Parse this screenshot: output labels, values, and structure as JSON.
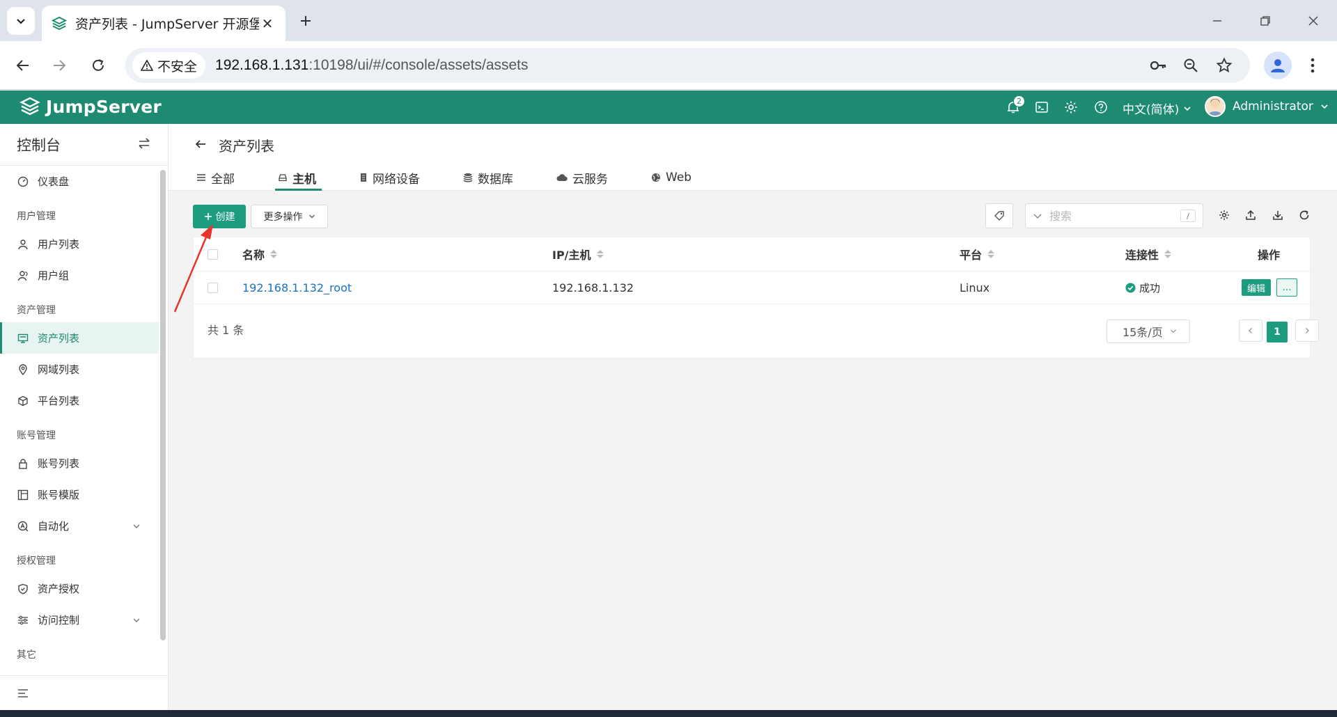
{
  "browser": {
    "tab_title": "资产列表 - JumpServer 开源堡",
    "security_label": "不安全",
    "url_host": "192.168.1.131",
    "url_rest": ":10198/ui/#/console/assets/assets"
  },
  "header": {
    "logo_text": "JumpServer",
    "notification_count": "2",
    "language": "中文(简体)",
    "user_name": "Administrator"
  },
  "sidebar": {
    "title": "控制台",
    "items": [
      {
        "type": "item",
        "label": "仪表盘",
        "icon": "dashboard-icon"
      },
      {
        "type": "group",
        "label": "用户管理"
      },
      {
        "type": "item",
        "label": "用户列表",
        "icon": "user-icon"
      },
      {
        "type": "item",
        "label": "用户组",
        "icon": "user-group-icon"
      },
      {
        "type": "group",
        "label": "资产管理"
      },
      {
        "type": "item",
        "label": "资产列表",
        "icon": "monitor-icon",
        "active": true
      },
      {
        "type": "item",
        "label": "网域列表",
        "icon": "location-icon"
      },
      {
        "type": "item",
        "label": "平台列表",
        "icon": "cube-icon"
      },
      {
        "type": "group",
        "label": "账号管理"
      },
      {
        "type": "item",
        "label": "账号列表",
        "icon": "lock-icon"
      },
      {
        "type": "item",
        "label": "账号模版",
        "icon": "template-icon"
      },
      {
        "type": "item",
        "label": "自动化",
        "icon": "automation-icon",
        "expandable": true
      },
      {
        "type": "group",
        "label": "授权管理"
      },
      {
        "type": "item",
        "label": "资产授权",
        "icon": "shield-icon"
      },
      {
        "type": "item",
        "label": "访问控制",
        "icon": "access-control-icon",
        "expandable": true
      },
      {
        "type": "group",
        "label": "其它"
      }
    ]
  },
  "page": {
    "title": "资产列表",
    "tabs": [
      {
        "label": "全部",
        "icon": "list-icon"
      },
      {
        "label": "主机",
        "icon": "host-icon",
        "active": true
      },
      {
        "label": "网络设备",
        "icon": "network-device-icon"
      },
      {
        "label": "数据库",
        "icon": "database-icon"
      },
      {
        "label": "云服务",
        "icon": "cloud-icon"
      },
      {
        "label": "Web",
        "icon": "globe-icon"
      }
    ],
    "create_label": "创建",
    "more_actions_label": "更多操作",
    "search_placeholder": "搜索",
    "search_shortcut": "/"
  },
  "table": {
    "columns": [
      "名称",
      "IP/主机",
      "平台",
      "连接性",
      "操作"
    ],
    "rows": [
      {
        "name": "192.168.1.132_root",
        "ip": "192.168.1.132",
        "platform": "Linux",
        "connectivity": "成功",
        "edit_label": "编辑",
        "more_label": "..."
      }
    ],
    "total_label": "共 1 条",
    "page_size_label": "15条/页",
    "current_page": "1"
  },
  "colors": {
    "brand": "#1e8a72",
    "button": "#1e9c80",
    "link": "#1a72c0",
    "annotation_arrow": "#e8322a"
  }
}
